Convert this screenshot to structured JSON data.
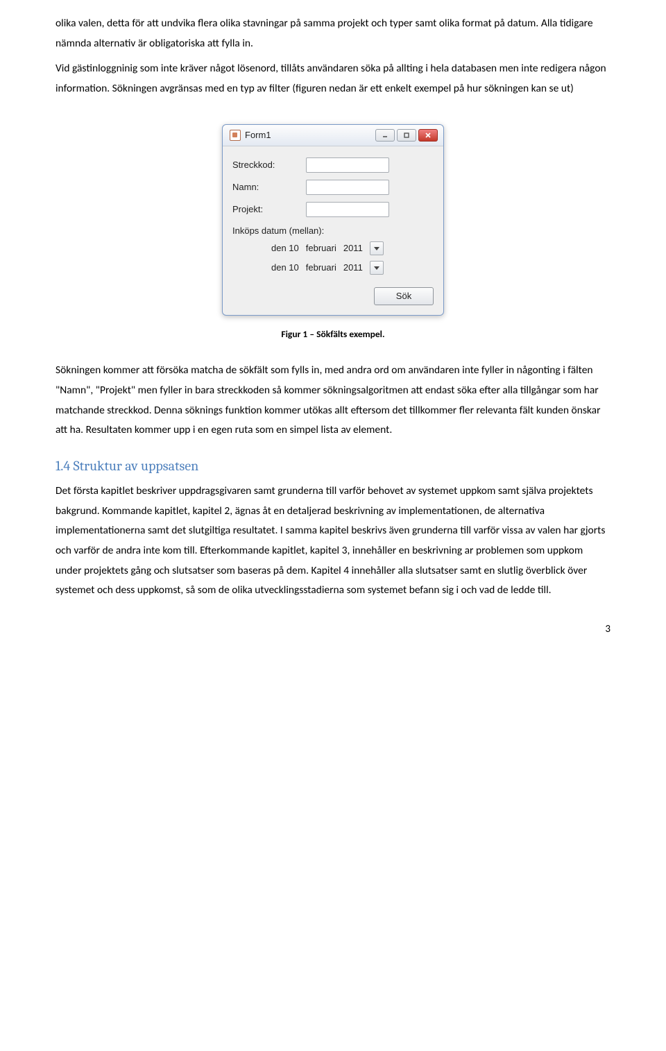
{
  "para1": "olika valen, detta för att undvika flera olika stavningar på samma projekt och typer samt olika format på datum. Alla tidigare nämnda alternativ är obligatoriska att fylla in.",
  "para2": "Vid gästinloggninig som inte kräver något lösenord, tillåts användaren söka på allting i hela databasen men inte redigera någon information. Sökningen avgränsas med en typ av filter (figuren nedan är ett enkelt exempel på hur sökningen kan se ut)",
  "form": {
    "title": "Form1",
    "labels": {
      "streckkod": "Streckkod:",
      "namn": "Namn:",
      "projekt": "Projekt:",
      "inkops": "Inköps datum (mellan):"
    },
    "date1": {
      "day": "den 10",
      "month": "februari",
      "year": "2011"
    },
    "date2": {
      "day": "den 10",
      "month": "februari",
      "year": "2011"
    },
    "search": "Sök"
  },
  "caption": "Figur 1 – Sökfälts exempel.",
  "para3": "Sökningen kommer att försöka matcha de sökfält som fylls in, med andra ord om användaren inte fyller in någonting i fälten \"Namn\", \"Projekt\" men fyller in bara streckkoden så kommer sökningsalgoritmen att endast söka efter alla tillgångar som har matchande streckkod. Denna söknings funktion kommer utökas allt eftersom det tillkommer fler relevanta fält kunden önskar att ha. Resultaten kommer upp i en egen ruta som en simpel lista av element.",
  "section_heading": "1.4 Struktur av uppsatsen",
  "para4": "Det första kapitlet beskriver uppdragsgivaren samt grunderna till varför behovet av systemet uppkom samt själva projektets bakgrund. Kommande kapitlet, kapitel 2, ägnas åt en detaljerad beskrivning av implementationen, de alternativa implementationerna samt det slutgiltiga resultatet. I samma kapitel beskrivs även grunderna till varför vissa av valen har gjorts och varför de andra inte kom till.  Efterkommande kapitlet, kapitel 3, innehåller en beskrivning ar problemen som uppkom under projektets gång och slutsatser som baseras på dem. Kapitel 4 innehåller alla slutsatser samt en slutlig överblick över systemet och dess uppkomst, så som de olika utvecklingsstadierna som systemet befann sig i och vad de ledde till.",
  "page_number": "3"
}
